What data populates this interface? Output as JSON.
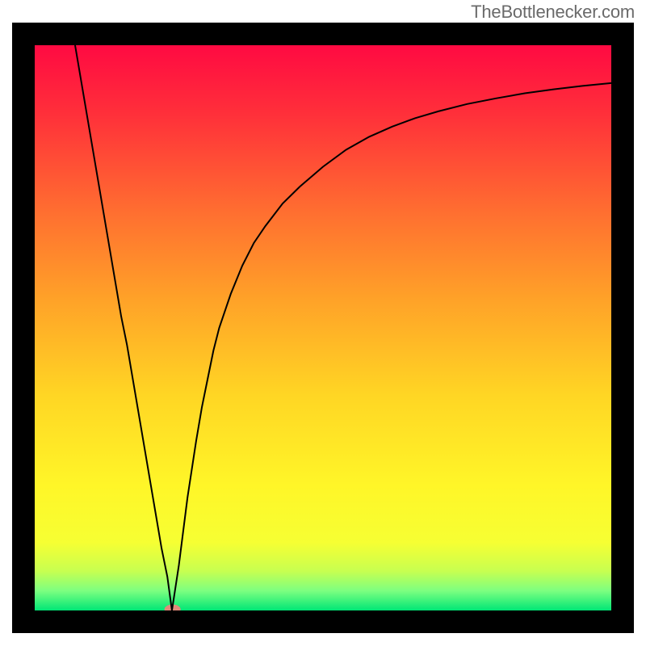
{
  "watermark": "TheBottlenecker.com",
  "chart_data": {
    "type": "line",
    "title": "",
    "xlabel": "",
    "ylabel": "",
    "xlim": [
      0,
      100
    ],
    "ylim": [
      0,
      100
    ],
    "background": {
      "type": "vertical-gradient",
      "stops": [
        {
          "pos": 0.0,
          "color": "#ff0a42"
        },
        {
          "pos": 0.12,
          "color": "#ff2f3a"
        },
        {
          "pos": 0.3,
          "color": "#ff7030"
        },
        {
          "pos": 0.45,
          "color": "#ffa228"
        },
        {
          "pos": 0.62,
          "color": "#ffd624"
        },
        {
          "pos": 0.78,
          "color": "#fff628"
        },
        {
          "pos": 0.88,
          "color": "#f6ff33"
        },
        {
          "pos": 0.93,
          "color": "#c8ff50"
        },
        {
          "pos": 0.965,
          "color": "#7dff80"
        },
        {
          "pos": 1.0,
          "color": "#00e676"
        }
      ]
    },
    "series": [
      {
        "name": "bottleneck-curve",
        "color": "#000000",
        "x": [
          7,
          8,
          9,
          10,
          11,
          12,
          13,
          14,
          15,
          16,
          17,
          18,
          19,
          20,
          21,
          22,
          23,
          23.8,
          25,
          26.5,
          28,
          29,
          31,
          32,
          34,
          36,
          38,
          40,
          43,
          46,
          50,
          54,
          58,
          62,
          66,
          70,
          75,
          80,
          85,
          90,
          95,
          100
        ],
        "y": [
          100,
          94,
          88,
          82,
          76,
          70,
          64,
          58,
          52,
          47,
          41,
          35,
          29,
          23,
          17,
          11,
          6,
          0,
          8,
          20,
          30,
          36,
          46,
          50,
          56,
          61,
          65,
          68,
          72,
          75,
          78.5,
          81.5,
          83.8,
          85.6,
          87.1,
          88.3,
          89.6,
          90.6,
          91.5,
          92.2,
          92.8,
          93.3
        ]
      }
    ],
    "markers": [
      {
        "name": "min-marker",
        "x": 23.9,
        "y": 0.2,
        "color": "#e08a7a",
        "rx": 10,
        "ry": 6
      }
    ],
    "border": {
      "color": "#000000",
      "width": 28
    },
    "grid": false,
    "legend": false
  }
}
